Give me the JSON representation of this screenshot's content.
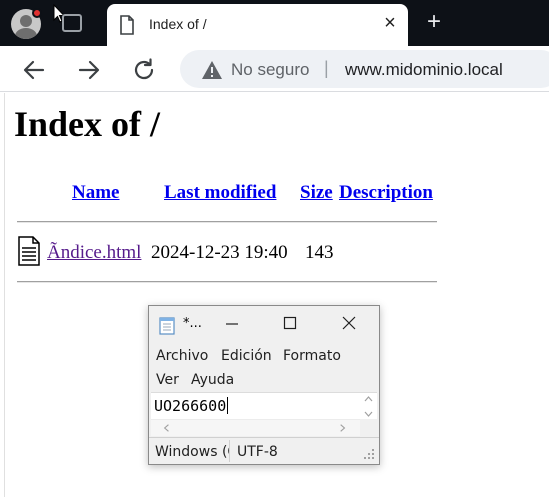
{
  "browser": {
    "tab": {
      "title": "Index of /"
    },
    "address_bar": {
      "security_label": "No seguro",
      "url": "www.midominio.local"
    }
  },
  "page": {
    "heading": "Index of /",
    "columns": [
      "Name",
      "Last modified",
      "Size",
      "Description"
    ],
    "rows": [
      {
        "name": "Ãndice.html",
        "modified": "2024-12-23 19:40",
        "size": "143",
        "description": ""
      }
    ]
  },
  "notepad": {
    "title": "*...",
    "menu": [
      "Archivo",
      "Edición",
      "Formato",
      "Ver",
      "Ayuda"
    ],
    "content": "UO266600",
    "status": {
      "line_ending": "Windows (CRLF)",
      "encoding": "UTF-8"
    }
  },
  "colors": {
    "tabstrip": "#0d1117",
    "link": "#0000ee",
    "visited_link": "#551a8b",
    "omnibox": "#eef1f5",
    "profile_badge": "#e03131"
  },
  "icons": [
    "profile-avatar",
    "tab-actions-icon",
    "page-icon",
    "close-icon",
    "plus-icon",
    "back-arrow-icon",
    "forward-arrow-icon",
    "reload-icon",
    "warning-icon",
    "document-icon",
    "notepad-icon",
    "minimize-icon",
    "maximize-icon",
    "close-icon",
    "size-grip-icon"
  ]
}
